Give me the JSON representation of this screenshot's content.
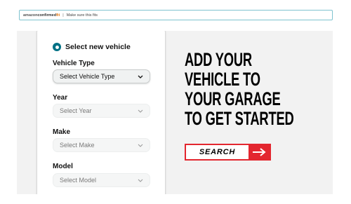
{
  "topbar": {
    "brand_part1": "amazon",
    "brand_part2": "confirmed",
    "brand_part3": "fit",
    "separator": "|",
    "tagline": "Make sure this fits"
  },
  "selector": {
    "radio_label": "Select new vehicle",
    "fields": [
      {
        "label": "Vehicle Type",
        "placeholder": "Select Vehicle Type",
        "state": "active"
      },
      {
        "label": "Year",
        "placeholder": "Select Year",
        "state": "disabled"
      },
      {
        "label": "Make",
        "placeholder": "Select Make",
        "state": "disabled"
      },
      {
        "label": "Model",
        "placeholder": "Select Model",
        "state": "disabled"
      }
    ]
  },
  "promo": {
    "headline_lines": [
      "ADD YOUR",
      "VEHICLE TO",
      "YOUR GARAGE",
      "TO GET STARTED"
    ],
    "search_label": "SEARCH",
    "search_icon": "arrow-right-icon",
    "accent_color": "#e3262f"
  },
  "colors": {
    "radio_accent": "#007185",
    "hero_background": "#f2f2f2",
    "topbar_border": "#7ec3cf"
  }
}
